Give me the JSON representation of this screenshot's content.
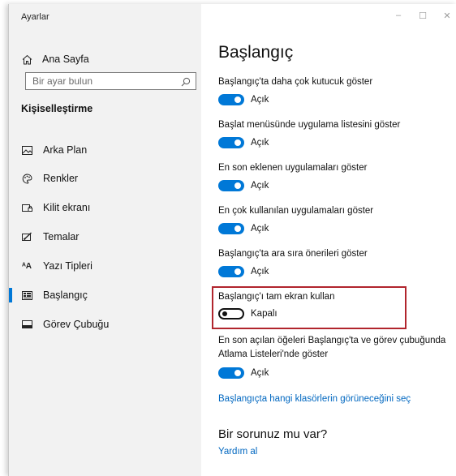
{
  "app": {
    "title": "Ayarlar"
  },
  "window_controls": {
    "minimize": "–",
    "maximize": "☐",
    "close": "✕"
  },
  "sidebar": {
    "home_label": "Ana Sayfa",
    "search_placeholder": "Bir ayar bulun",
    "section_title": "Kişiselleştirme",
    "items": [
      {
        "label": "Arka Plan",
        "icon": "picture-icon"
      },
      {
        "label": "Renkler",
        "icon": "palette-icon"
      },
      {
        "label": "Kilit ekranı",
        "icon": "lock-screen-icon"
      },
      {
        "label": "Temalar",
        "icon": "brush-icon"
      },
      {
        "label": "Yazı Tipleri",
        "icon": "font-icon"
      },
      {
        "label": "Başlangıç",
        "icon": "start-menu-icon",
        "active": true
      },
      {
        "label": "Görev Çubuğu",
        "icon": "taskbar-icon"
      }
    ]
  },
  "main": {
    "title": "Başlangıç",
    "settings": [
      {
        "label": "Başlangıç'ta daha çok kutucuk göster",
        "state": "Açık",
        "on": true
      },
      {
        "label": "Başlat menüsünde uygulama listesini göster",
        "state": "Açık",
        "on": true
      },
      {
        "label": "En son eklenen uygulamaları göster",
        "state": "Açık",
        "on": true
      },
      {
        "label": "En çok kullanılan uygulamaları göster",
        "state": "Açık",
        "on": true
      },
      {
        "label": "Başlangıç'ta ara sıra önerileri göster",
        "state": "Açık",
        "on": true
      },
      {
        "label": "Başlangıç'ı tam ekran kullan",
        "state": "Kapalı",
        "on": false
      },
      {
        "label": "En son açılan öğeleri Başlangıç'ta ve görev çubuğunda Atlama Listeleri'nde göster",
        "state": "Açık",
        "on": true
      }
    ],
    "folders_link": "Başlangıçta hangi klasörlerin görüneceğini seç",
    "help_title": "Bir sorunuz mu var?",
    "help_link": "Yardım al"
  },
  "colors": {
    "accent": "#0078d7",
    "link": "#0067c0",
    "highlight_border": "#b1252d",
    "sidebar_bg": "#f2f2f2"
  }
}
